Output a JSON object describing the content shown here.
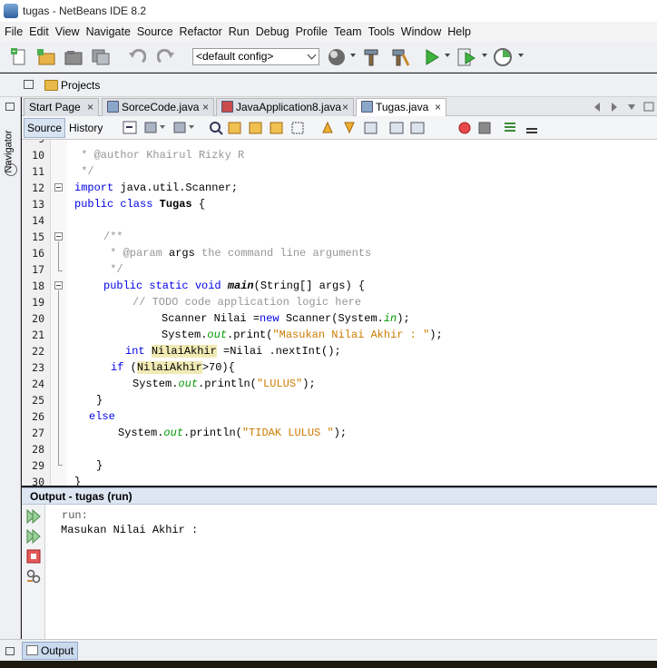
{
  "window": {
    "title": "tugas - NetBeans IDE 8.2"
  },
  "menu": [
    "File",
    "Edit",
    "View",
    "Navigate",
    "Source",
    "Refactor",
    "Run",
    "Debug",
    "Profile",
    "Team",
    "Tools",
    "Window",
    "Help"
  ],
  "toolbar": {
    "config_value": "<default config>"
  },
  "projects_panel": {
    "label": "Projects"
  },
  "side_panel": {
    "navigator_label": "Navigator"
  },
  "tabs": [
    {
      "label": "Start Page",
      "active": false
    },
    {
      "label": "SorceCode.java",
      "active": false
    },
    {
      "label": "JavaApplication8.java",
      "active": false
    },
    {
      "label": "Tugas.java",
      "active": true
    }
  ],
  "editor_toolbar": {
    "source_label": "Source",
    "history_label": "History"
  },
  "editor": {
    "line_numbers": [
      "9",
      "10",
      "11",
      "12",
      "13",
      "14",
      "15",
      "16",
      "17",
      "18",
      "19",
      "20",
      "21",
      "22",
      "23",
      "24",
      "25",
      "26",
      "27",
      "28",
      "29",
      "30"
    ],
    "lines": {
      "l10": " * @author Khairul Rizky R",
      "l11": " */",
      "l12_a": "import",
      "l12_b": " java.util.Scanner;",
      "l13_a": "public class",
      "l13_b": " Tugas",
      "l13_c": " {",
      "l15": "/**",
      "l16_a": " * @param",
      "l16_b": " args",
      "l16_c": " the command line arguments",
      "l17": " */",
      "l18_a": "public static void",
      "l18_b": " main",
      "l18_c": "(String[] args) {",
      "l19": "// TODO code application logic here",
      "l20_a": "Scanner Nilai =",
      "l20_b": "new",
      "l20_c": " Scanner(System.",
      "l20_d": "in",
      "l20_e": ");",
      "l21_a": "System.",
      "l21_b": "out",
      "l21_c": ".print(",
      "l21_d": "\"Masukan Nilai Akhir : \"",
      "l21_e": ");",
      "l22_a": "int",
      "l22_b": "NilaiAkhir",
      "l22_c": " =Nilai .nextInt();",
      "l23_a": "if",
      "l23_b": " (",
      "l23_c": "NilaiAkhir",
      "l23_d": ">70){",
      "l24_a": "System.",
      "l24_b": "out",
      "l24_c": ".println(",
      "l24_d": "\"LULUS\"",
      "l24_e": ");",
      "l25": "}",
      "l26": "else",
      "l27_a": "System.",
      "l27_b": "out",
      "l27_c": ".println(",
      "l27_d": "\"TIDAK LULUS \"",
      "l27_e": ");",
      "l29": "}",
      "l30": "}"
    }
  },
  "output": {
    "title": "Output - tugas (run)",
    "lines": [
      "run:",
      "Masukan Nilai Akhir :"
    ],
    "tab_label": "Output"
  }
}
